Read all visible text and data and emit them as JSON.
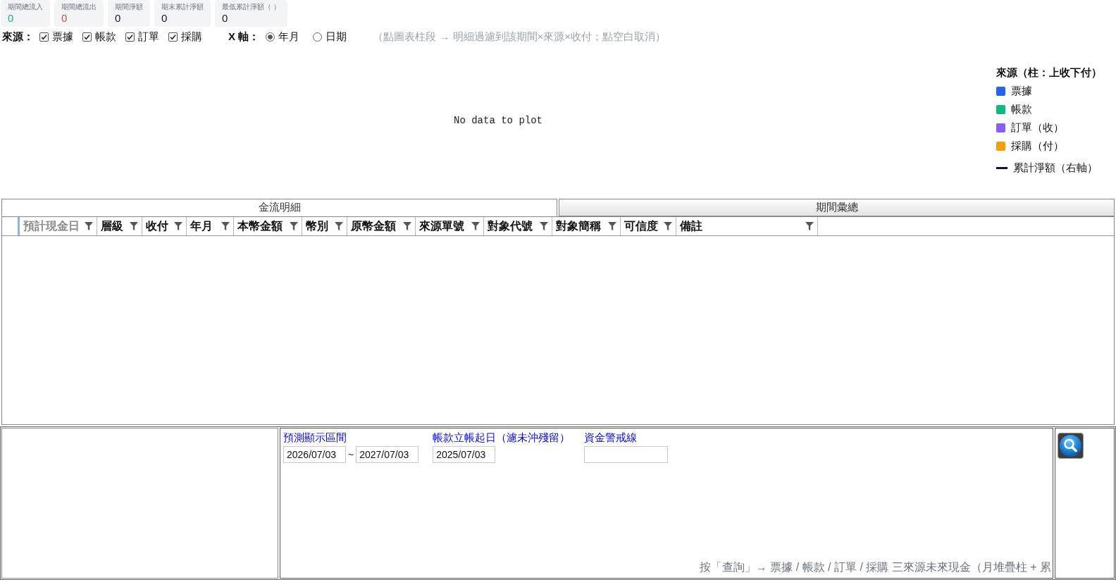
{
  "kpis": [
    {
      "label": "期間總流入",
      "value": "0",
      "color": "#10b981"
    },
    {
      "label": "期間總流出",
      "value": "0",
      "color": "#ef4444"
    },
    {
      "label": "期間淨額",
      "value": "0",
      "color": "#111827"
    },
    {
      "label": "期末累計淨額",
      "value": "0",
      "color": "#111827"
    },
    {
      "label": "最低累計淨額（ ）",
      "value": "0",
      "color": "#111827"
    }
  ],
  "filters": {
    "sources_label": "來源：",
    "sources": [
      {
        "label": "票據",
        "checked": true
      },
      {
        "label": "帳款",
        "checked": true
      },
      {
        "label": "訂單",
        "checked": true
      },
      {
        "label": "採購",
        "checked": true
      }
    ],
    "x_axis_label": "X 軸：",
    "x_axis_options": [
      {
        "label": "年月",
        "selected": true
      },
      {
        "label": "日期",
        "selected": false
      }
    ],
    "hint": "（點圖表柱段 → 明細過濾到該期間×來源×收付；點空白取消）"
  },
  "chart": {
    "message": "No data to plot",
    "legend": {
      "title": "來源（柱：上收下付）",
      "items": [
        {
          "label": "票據",
          "kind": "bar",
          "color": "#2563eb"
        },
        {
          "label": "帳款",
          "kind": "bar",
          "color": "#10b981"
        },
        {
          "label": "訂單（收）",
          "kind": "bar",
          "color": "#8b5cf6"
        },
        {
          "label": "採購（付）",
          "kind": "bar",
          "color": "#f59e0b"
        },
        {
          "label": "累計淨額（右軸）",
          "kind": "line",
          "color": "#0f172a"
        }
      ]
    }
  },
  "tabs": [
    {
      "label": "金流明細",
      "selected": true
    },
    {
      "label": "期間彙總",
      "selected": false
    }
  ],
  "table": {
    "columns": [
      {
        "label": "預計現金日",
        "selected": true
      },
      {
        "label": "層級",
        "selected": false
      },
      {
        "label": "收付",
        "selected": false
      },
      {
        "label": "年月",
        "selected": false
      },
      {
        "label": "本幣金額",
        "selected": false
      },
      {
        "label": "幣別",
        "selected": false
      },
      {
        "label": "原幣金額",
        "selected": false
      },
      {
        "label": "來源單號",
        "selected": false
      },
      {
        "label": "對象代號",
        "selected": false
      },
      {
        "label": "對象簡稱",
        "selected": false
      },
      {
        "label": "可信度",
        "selected": false
      },
      {
        "label": "備註",
        "selected": false
      }
    ]
  },
  "query_panel": {
    "fields": [
      {
        "label": "預測顯示區間",
        "kind": "range",
        "values": [
          "2026/07/03",
          "2027/07/03"
        ],
        "separator": "~"
      },
      {
        "label": "帳款立帳起日（濾未沖殘留）",
        "kind": "single",
        "values": [
          "2025/07/03"
        ]
      },
      {
        "label": "資金警戒線",
        "kind": "wide"
      }
    ],
    "note": "按「查詢」→ 票據 / 帳款 / 訂單 / 採購 三來源未來現金（月堆疊柱 + 累"
  }
}
